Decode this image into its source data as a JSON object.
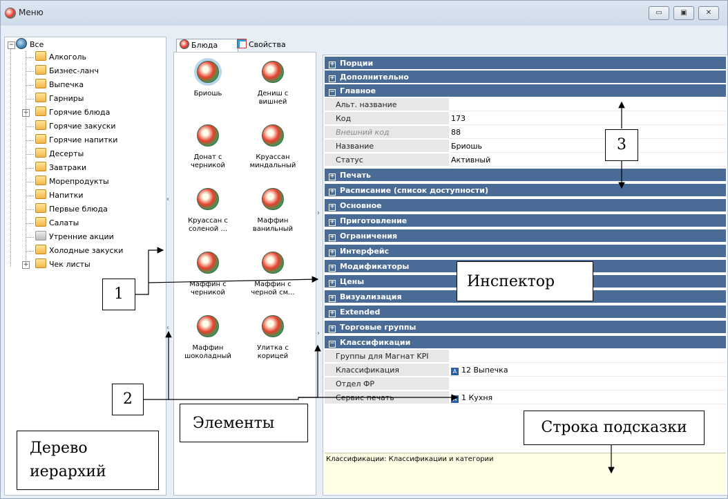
{
  "window": {
    "title": "Меню",
    "controls": {
      "minimize": "▭",
      "maximize": "▣",
      "close": "✕"
    }
  },
  "tree": {
    "root": "Все",
    "items": [
      {
        "label": "Алкоголь"
      },
      {
        "label": "Бизнес-ланч"
      },
      {
        "label": "Выпечка"
      },
      {
        "label": "Гарниры"
      },
      {
        "label": "Горячие блюда",
        "expandable": true
      },
      {
        "label": "Горячие закуски"
      },
      {
        "label": "Горячие напитки"
      },
      {
        "label": "Десерты"
      },
      {
        "label": "Завтраки"
      },
      {
        "label": "Морепродукты"
      },
      {
        "label": "Напитки"
      },
      {
        "label": "Первые блюда"
      },
      {
        "label": "Салаты"
      },
      {
        "label": "Утренние акции"
      },
      {
        "label": "Холодные закуски"
      },
      {
        "label": "Чек листы",
        "expandable": true
      }
    ]
  },
  "tabs": [
    {
      "label": "Блюда",
      "icon": "dish-icon",
      "active": true
    },
    {
      "label": "Свойства",
      "icon": "properties-icon",
      "active": false
    }
  ],
  "elements": [
    {
      "name_line1": "Бриошь",
      "name_line2": ""
    },
    {
      "name_line1": "Дениш с",
      "name_line2": "вишней"
    },
    {
      "name_line1": "Донат с",
      "name_line2": "черникой"
    },
    {
      "name_line1": "Круассан",
      "name_line2": "миндальный"
    },
    {
      "name_line1": "Круассан с",
      "name_line2": "соленой ..."
    },
    {
      "name_line1": "Маффин",
      "name_line2": "ванильный"
    },
    {
      "name_line1": "Маффин с",
      "name_line2": "черникой"
    },
    {
      "name_line1": "Маффин с",
      "name_line2": "черной см..."
    },
    {
      "name_line1": "Маффин",
      "name_line2": "шоколадный"
    },
    {
      "name_line1": "Улитка с",
      "name_line2": "корицей"
    }
  ],
  "inspector": {
    "sections": {
      "portions": "Порции",
      "additional": "Дополнительно",
      "main": "Главное",
      "print": "Печать",
      "schedule": "Расписание (список доступности)",
      "basic": "Основное",
      "cooking": "Приготовление",
      "limits": "Ограничения",
      "interface": "Интерфейс",
      "modifiers": "Модификаторы",
      "prices": "Цены",
      "visualization": "Визуализация",
      "extended": "Extended",
      "trade_groups": "Торговые группы",
      "classifications": "Классификации"
    },
    "expand_glyph": "+",
    "collapse_glyph": "−",
    "main_props": [
      {
        "name": "Альт. название",
        "value": ""
      },
      {
        "name": "Код",
        "value": "173"
      },
      {
        "name": "Внешний код",
        "value": "88"
      },
      {
        "name": "Название",
        "value": "Бриошь"
      },
      {
        "name": "Статус",
        "value": "Активный"
      }
    ],
    "class_props": [
      {
        "name": "Группы для Магнат KPI",
        "value": "",
        "badge": ""
      },
      {
        "name": "Классификация",
        "value": "12 Выпечка",
        "badge": "A"
      },
      {
        "name": "Отдел ФР",
        "value": "",
        "badge": ""
      },
      {
        "name": "Сервис печать",
        "value": "1 Кухня",
        "badge": "A"
      }
    ],
    "hint": "Классификации: Классификации и категории"
  },
  "callouts": {
    "n1": "1",
    "n2": "2",
    "n3": "3",
    "inspector": "Инспектор",
    "elements": "Элементы",
    "hint_line": "Строка подсказки",
    "tree_line1": "Дерево",
    "tree_line2": "иерархий"
  },
  "splitter_glyphs": {
    "left": "‹",
    "right": "›"
  }
}
